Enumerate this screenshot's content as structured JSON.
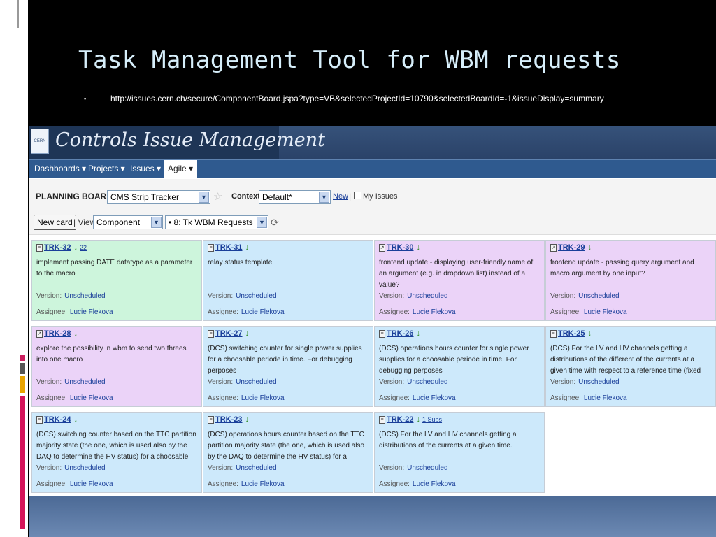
{
  "slide": {
    "title": "Task Management Tool for WBM requests",
    "bullet": "▪",
    "url": "http://issues.cern.ch/secure/ComponentBoard.jspa?type=VB&selectedProjectId=10790&selectedBoardId=-1&issueDisplay=summary"
  },
  "app": {
    "title": "Controls Issue Management",
    "logo_text": "CERN"
  },
  "menu": {
    "dashboards": "Dashboards ▾",
    "projects": "Projects ▾",
    "issues": "Issues ▾",
    "agile": "Agile ▾"
  },
  "board_header": {
    "planning_label": "PLANNING BOARD -",
    "project_select": "CMS Strip Tracker",
    "context_label": "Context:",
    "context_select": "Default*",
    "new_link": "New",
    "separator": "|",
    "my_issues_label": "My Issues",
    "new_card_button": "New card",
    "view_label": "| View",
    "view_select": "Component",
    "component_select": "• 8: Tk WBM Requests"
  },
  "labels": {
    "version": "Version:",
    "assignee": "Assignee:"
  },
  "cards": [
    {
      "key": "TRK-32",
      "type": "task",
      "extra": "22",
      "color": "green",
      "summary": "implement passing DATE datatype as a parameter to the macro",
      "version": "Unscheduled",
      "assignee": "Lucie Flekova"
    },
    {
      "key": "TRK-31",
      "type": "task",
      "extra": "",
      "color": "blue",
      "summary": "relay status template",
      "version": "Unscheduled",
      "assignee": "Lucie Flekova"
    },
    {
      "key": "TRK-30",
      "type": "improvement",
      "extra": "",
      "color": "purple",
      "summary": "frontend update - displaying user-friendly name of an argument (e.g. in dropdown list) instead of a value?",
      "version": "Unscheduled",
      "assignee": "Lucie Flekova"
    },
    {
      "key": "TRK-29",
      "type": "improvement",
      "extra": "",
      "color": "purple",
      "summary": "frontend update - passing query argument and macro argument by one input?",
      "version": "Unscheduled",
      "assignee": "Lucie Flekova"
    },
    {
      "key": "TRK-28",
      "type": "improvement",
      "extra": "",
      "color": "purple",
      "summary": "explore the possibility in wbm to send two threes into one macro",
      "version": "Unscheduled",
      "assignee": "Lucie Flekova"
    },
    {
      "key": "TRK-27",
      "type": "task",
      "extra": "",
      "color": "blue",
      "summary": "(DCS) switching counter for single power supplies for a choosable periode in time. For debugging perposes",
      "version": "Unscheduled",
      "assignee": "Lucie Flekova"
    },
    {
      "key": "TRK-26",
      "type": "task",
      "extra": "",
      "color": "blue",
      "summary": "(DCS) operations hours counter for single power supplies for a choosable periode in time. For debugging perposes",
      "version": "Unscheduled",
      "assignee": "Lucie Flekova"
    },
    {
      "key": "TRK-25",
      "type": "task",
      "extra": "",
      "color": "blue",
      "summary": "(DCS) For the LV and HV channels getting a distributions of the different of the currents at a given time with respect to a reference time (fixed and tagged once as well as",
      "version": "Unscheduled",
      "assignee": "Lucie Flekova"
    },
    {
      "key": "TRK-24",
      "type": "task",
      "extra": "",
      "color": "blue",
      "summary": "(DCS) switching counter based on the TTC partition majority state (the one, which is used also by the DAQ to determine the HV status) for a choosable periode in time.",
      "version": "Unscheduled",
      "assignee": "Lucie Flekova"
    },
    {
      "key": "TRK-23",
      "type": "task",
      "extra": "",
      "color": "blue",
      "summary": "(DCS) operations hours counter based on the TTC partition majority state (the one, which is used also by the DAQ to determine the HV status) for a choosable periode in time.",
      "version": "Unscheduled",
      "assignee": "Lucie Flekova"
    },
    {
      "key": "TRK-22",
      "type": "task",
      "extra": "1 Subs",
      "color": "blue",
      "summary": "(DCS) For the LV and HV channels getting a distributions of the currents at a given time.",
      "version": "Unscheduled",
      "assignee": "Lucie Flekova"
    }
  ]
}
